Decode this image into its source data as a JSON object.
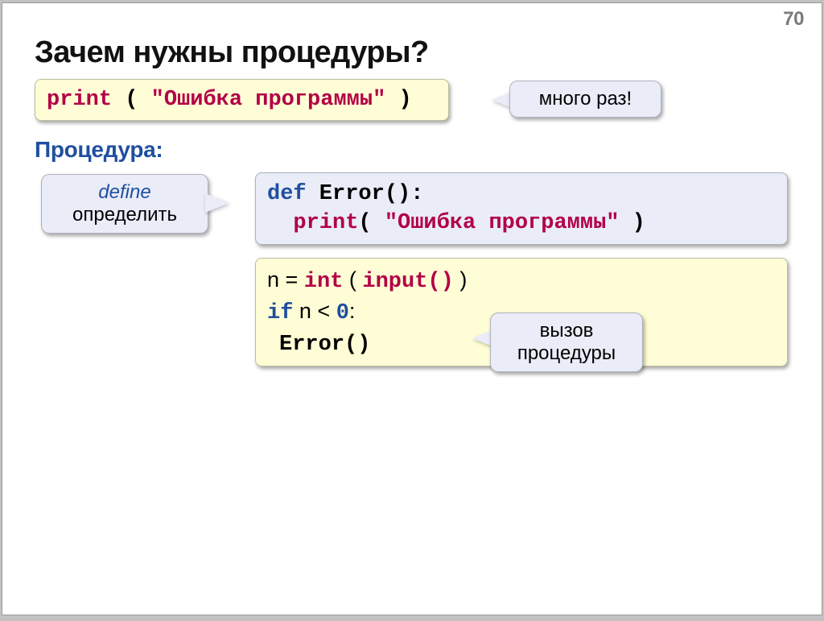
{
  "page_number": "70",
  "heading": "Зачем нужны процедуры?",
  "subheading": "Процедура:",
  "callouts": {
    "many_times": "много раз!",
    "define_en": "define",
    "define_ru": "определить",
    "call_l1": "вызов",
    "call_l2": "процедуры"
  },
  "code": {
    "print_kw": "print",
    "lp": " ( ",
    "lp2": "( ",
    "rp": " )",
    "err_str": "\"Ошибка программы\"",
    "def_kw": "def",
    "err_name": " Error():",
    "indent": "  ",
    "n_eq": "n = ",
    "int_kw": "int",
    "input_kw": "input()",
    "if_kw": "if",
    "cond": " n < ",
    "zero": "0",
    "colon": ":",
    "err_call": "Error()"
  }
}
